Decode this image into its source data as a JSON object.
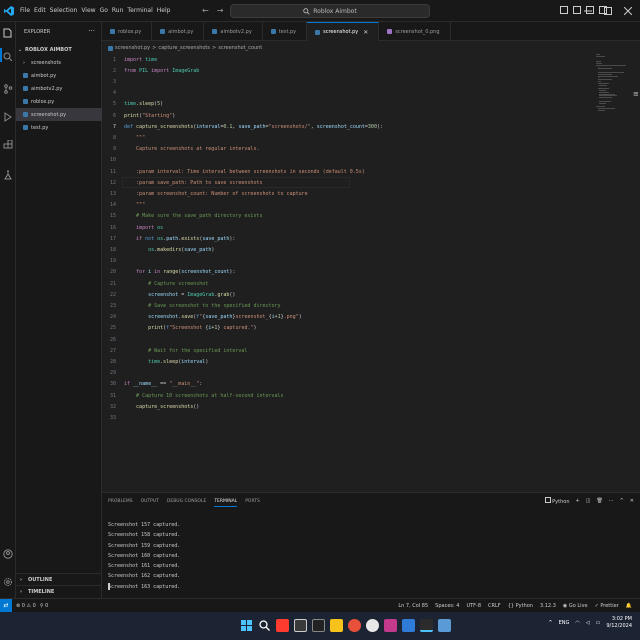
{
  "titlebar": {
    "menu": [
      "File",
      "Edit",
      "Selection",
      "View",
      "Go",
      "Run",
      "Terminal",
      "Help"
    ],
    "search_text": "Roblox Aimbot"
  },
  "sidebar": {
    "title": "EXPLORER",
    "more": "···",
    "folder": "ROBLOX AIMBOT",
    "items": [
      {
        "label": "screenshots",
        "type": "folder"
      },
      {
        "label": "aimbot.py",
        "type": "py"
      },
      {
        "label": "aimbotv2.py",
        "type": "py"
      },
      {
        "label": "roblox.py",
        "type": "py"
      },
      {
        "label": "screenshot.py",
        "type": "py",
        "selected": true
      },
      {
        "label": "test.py",
        "type": "py"
      }
    ],
    "outline": "OUTLINE",
    "timeline": "TIMELINE"
  },
  "tabs": [
    {
      "label": "roblox.py",
      "icon": "python-file-icon"
    },
    {
      "label": "aimbot.py",
      "icon": "python-file-icon"
    },
    {
      "label": "aimbotv2.py",
      "icon": "python-file-icon"
    },
    {
      "label": "test.py",
      "icon": "python-file-icon"
    },
    {
      "label": "screenshot.py",
      "icon": "python-file-icon",
      "active": true,
      "close": "✕"
    },
    {
      "label": "screenshot_0.png",
      "icon": "image-file-icon"
    }
  ],
  "breadcrumb": {
    "file": "screenshot.py",
    "sep": ">",
    "function": "capture_screenshots",
    "param": "screenshot_count"
  },
  "code": [
    {
      "n": "1",
      "html": "<span class='kw'>import</span> <span class='cls'>time</span>"
    },
    {
      "n": "2",
      "html": "<span class='kw'>from</span> <span class='cls'>PIL</span> <span class='kw'>import</span> <span class='cls'>ImageGrab</span>"
    },
    {
      "n": "3",
      "html": ""
    },
    {
      "n": "4",
      "html": ""
    },
    {
      "n": "5",
      "html": "<span class='cls'>time</span>.<span class='fn'>sleep</span>(<span class='num'>5</span>)"
    },
    {
      "n": "6",
      "html": "<span class='fn'>print</span>(<span class='str'>\"Starting\"</span>)"
    },
    {
      "n": "7",
      "html": "<span class='kwb'>def</span> <span class='fn'>capture_screenshots</span>(<span class='var'>interval</span>=<span class='num'>0.1</span>, <span class='var'>save_path</span>=<span class='str'>\"screenshots/\"</span>, <span class='var'>screenshot_count</span>=<span class='num'>300</span>):"
    },
    {
      "n": "8",
      "html": "    <span class='str'>\"\"\"</span>"
    },
    {
      "n": "9",
      "html": "    <span class='str'>Capture screenshots at regular intervals.</span>"
    },
    {
      "n": "10",
      "html": ""
    },
    {
      "n": "11",
      "html": "    <span class='str'>:param interval: Time interval between screenshots in seconds (default 0.5s)</span>"
    },
    {
      "n": "12",
      "html": "    <span class='str'>:param save_path: Path to save screenshots</span>"
    },
    {
      "n": "13",
      "html": "    <span class='str'>:param screenshot_count: Number of screenshots to capture</span>"
    },
    {
      "n": "14",
      "html": "    <span class='str'>\"\"\"</span>"
    },
    {
      "n": "15",
      "html": "    <span class='cm'># Make sure the save_path directory exists</span>"
    },
    {
      "n": "16",
      "html": "    <span class='kw'>import</span> <span class='cls'>os</span>"
    },
    {
      "n": "17",
      "html": "    <span class='kw'>if</span> <span class='kwb'>not</span> <span class='cls'>os</span>.<span class='var'>path</span>.<span class='fn'>exists</span>(<span class='var'>save_path</span>):"
    },
    {
      "n": "18",
      "html": "        <span class='cls'>os</span>.<span class='fn'>makedirs</span>(<span class='var'>save_path</span>)"
    },
    {
      "n": "19",
      "html": ""
    },
    {
      "n": "20",
      "html": "    <span class='kw'>for</span> <span class='var'>i</span> <span class='kw'>in</span> <span class='fn'>range</span>(<span class='var'>screenshot_count</span>):"
    },
    {
      "n": "21",
      "html": "        <span class='cm'># Capture screenshot</span>"
    },
    {
      "n": "22",
      "html": "        <span class='var'>screenshot</span> = <span class='cls'>ImageGrab</span>.<span class='fn'>grab</span>()"
    },
    {
      "n": "23",
      "html": "        <span class='cm'># Save screenshot to the specified directory</span>"
    },
    {
      "n": "24",
      "html": "        <span class='var'>screenshot</span>.<span class='fn'>save</span>(<span class='kwb'>f</span><span class='str'>\"</span>{<span class='var'>save_path</span>}<span class='str'>screenshot_</span>{<span class='var'>i</span>+<span class='num'>1</span>}<span class='str'>.png\"</span>)"
    },
    {
      "n": "25",
      "html": "        <span class='fn'>print</span>(<span class='kwb'>f</span><span class='str'>\"Screenshot </span>{<span class='var'>i</span>+<span class='num'>1</span>}<span class='str'> captured.\"</span>)"
    },
    {
      "n": "26",
      "html": ""
    },
    {
      "n": "27",
      "html": "        <span class='cm'># Wait for the specified interval</span>"
    },
    {
      "n": "28",
      "html": "        <span class='cls'>time</span>.<span class='fn'>sleep</span>(<span class='var'>interval</span>)"
    },
    {
      "n": "29",
      "html": ""
    },
    {
      "n": "30",
      "html": "<span class='kw'>if</span> <span class='var'>__name__</span> == <span class='str'>\"__main__\"</span>:"
    },
    {
      "n": "31",
      "html": "    <span class='cm'># Capture 10 screenshots at half-second intervals</span>"
    },
    {
      "n": "32",
      "html": "    <span class='fn'>capture_screenshots</span>()"
    },
    {
      "n": "33",
      "html": ""
    }
  ],
  "current_line": "7",
  "panel": {
    "tabs": [
      "PROBLEMS",
      "OUTPUT",
      "DEBUG CONSOLE",
      "TERMINAL",
      "PORTS"
    ],
    "active_tab": "TERMINAL",
    "terminal_profile": "Python",
    "terminal_lines": [
      "Screenshot 157 captured.",
      "Screenshot 158 captured.",
      "Screenshot 159 captured.",
      "Screenshot 160 captured.",
      "Screenshot 161 captured.",
      "Screenshot 162 captured.",
      "Screenshot 163 captured."
    ]
  },
  "statusbar": {
    "errors": "0",
    "warnings": "0",
    "ports": "0",
    "position": "Ln 7, Col 85",
    "spaces": "Spaces: 4",
    "encoding": "UTF-8",
    "eol": "CRLF",
    "language": "Python",
    "version": "3.12.3",
    "golive": "Go Live",
    "prettier": "Prettier"
  },
  "taskbar": {
    "lang": "ENG",
    "time": "3:02 PM",
    "date": "9/12/2024"
  },
  "colors": {
    "accent": "#0078d4",
    "editor_bg": "#1f1f1f",
    "side_bg": "#181818",
    "taskbar_bg": "#1c2333"
  }
}
